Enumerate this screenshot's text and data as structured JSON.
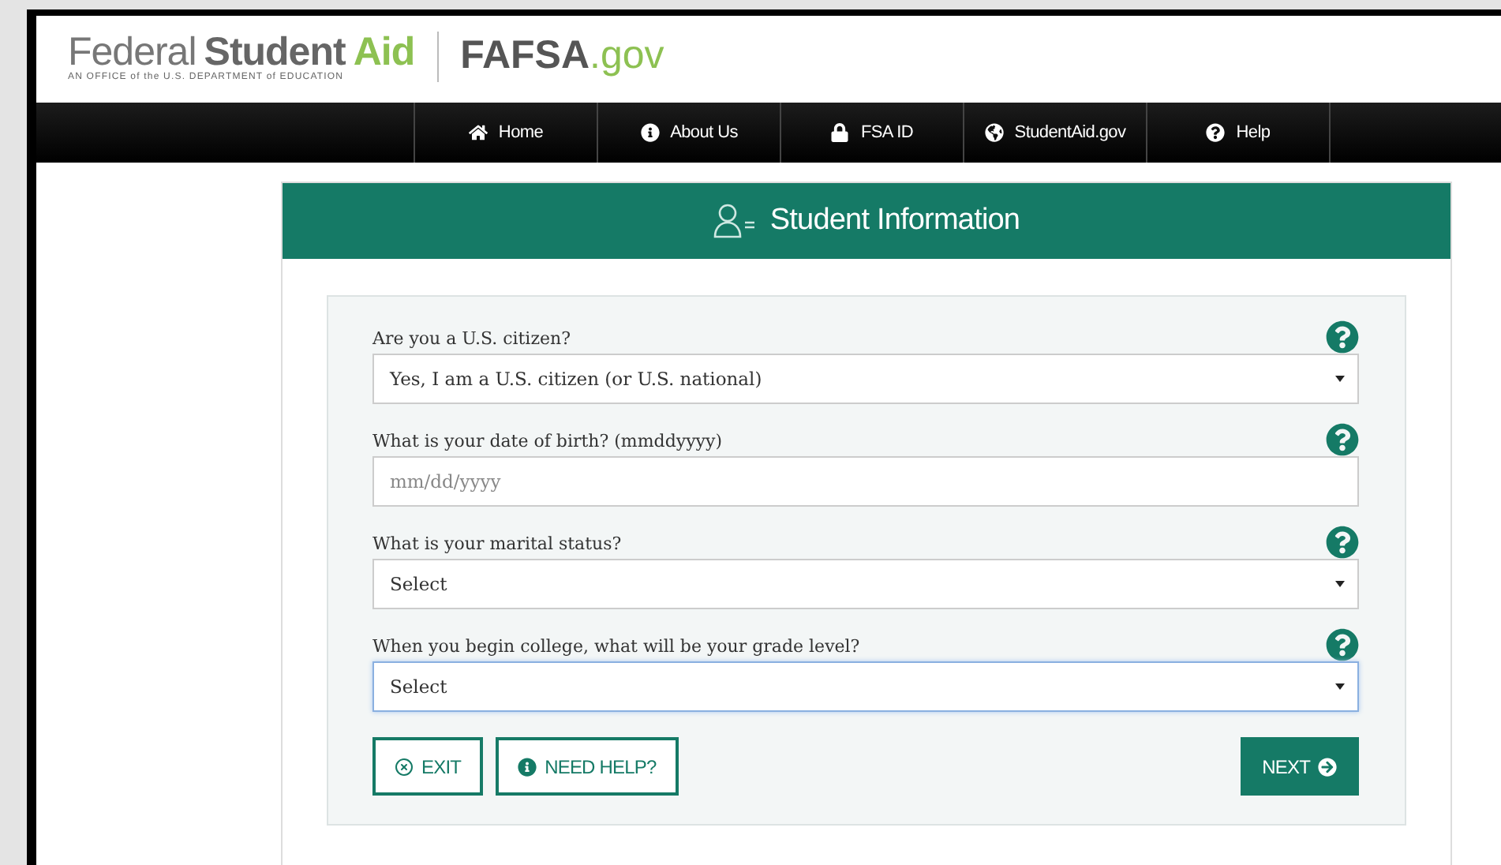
{
  "logo": {
    "word_1": "Federal",
    "word_2": "Student",
    "word_3": "Aid",
    "tagline": "AN OFFICE of the U.S. DEPARTMENT of EDUCATION",
    "site": "FAFSA",
    "site_suffix": ".gov"
  },
  "nav": [
    {
      "label": "Home"
    },
    {
      "label": "About Us"
    },
    {
      "label": "FSA ID"
    },
    {
      "label": "StudentAid.gov"
    },
    {
      "label": "Help"
    }
  ],
  "card": {
    "title": "Student Information"
  },
  "questions": [
    {
      "label": "Are you a U.S. citizen?",
      "kind": "select",
      "value": "Yes, I am a U.S. citizen (or U.S. national)",
      "focused": false
    },
    {
      "label": "What is your date of birth? (mmddyyyy)",
      "kind": "text",
      "placeholder": "mm/dd/yyyy",
      "focused": false
    },
    {
      "label": "What is your marital status?",
      "kind": "select",
      "value": "Select",
      "focused": false
    },
    {
      "label": "When you begin college, what will be your grade level?",
      "kind": "select",
      "value": "Select",
      "focused": true
    }
  ],
  "buttons": [
    {
      "label": "EXIT",
      "kind": "outline"
    },
    {
      "label": "NEED HELP?",
      "kind": "outline"
    },
    {
      "label": "NEXT",
      "kind": "solid"
    }
  ]
}
